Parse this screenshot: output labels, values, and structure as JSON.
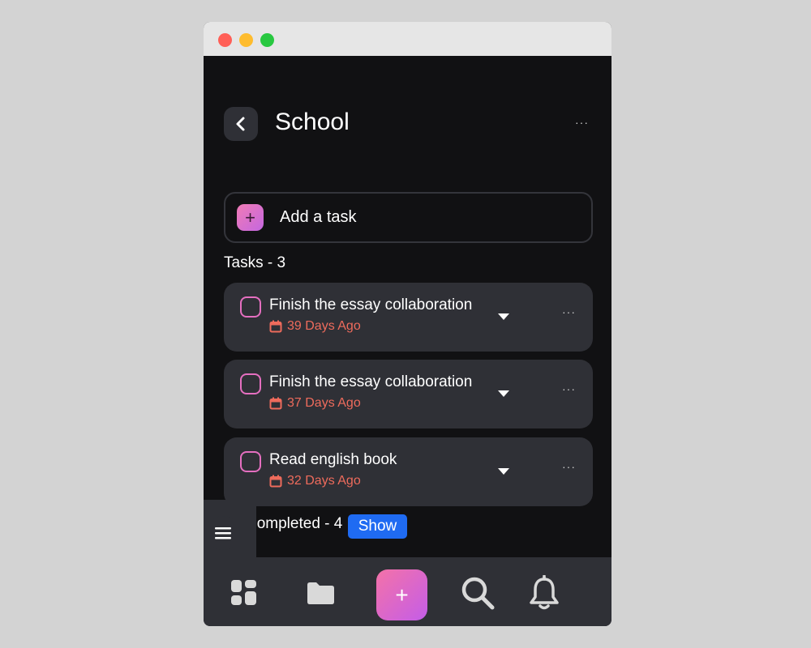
{
  "window": {
    "controls": [
      "close",
      "minimize",
      "maximize"
    ]
  },
  "header": {
    "back_icon": "chevron-left-icon",
    "title": "School",
    "more": "···"
  },
  "add_task": {
    "icon": "plus-icon",
    "plus": "+",
    "label": "Add a task"
  },
  "tasks": {
    "count_label": "Tasks - 3",
    "items": [
      {
        "title": "Finish the essay collaboration",
        "date": "39 Days Ago",
        "more": "···"
      },
      {
        "title": "Finish the essay collaboration",
        "date": "37 Days Ago",
        "more": "···"
      },
      {
        "title": "Read english book",
        "date": "32 Days Ago",
        "more": "···"
      }
    ]
  },
  "completed": {
    "label": "Completed - 4",
    "show_label": "Show"
  },
  "bottom_nav": {
    "items": [
      "dashboard-icon",
      "folder-icon",
      "plus-icon",
      "search-icon",
      "bell-icon"
    ],
    "fab": "+"
  },
  "colors": {
    "accent_pink": "#e56fc0",
    "date_red": "#ee6b5c",
    "show_blue": "#1f6bf2",
    "card_bg": "#2f3036",
    "app_bg": "#111113"
  }
}
